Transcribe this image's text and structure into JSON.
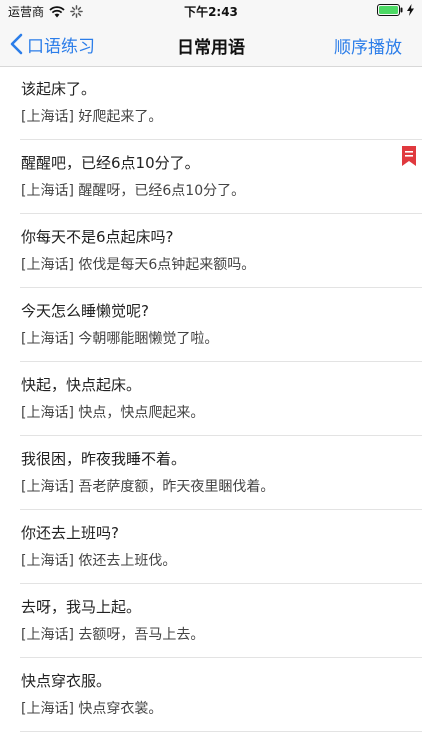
{
  "status_bar": {
    "carrier": "运营商",
    "time": "下午2:43"
  },
  "nav": {
    "back_label": "口语练习",
    "title": "日常用语",
    "play_label": "顺序播放"
  },
  "phrases": [
    {
      "mandarin": "该起床了。",
      "shanghainese": "[上海话] 好爬起来了。",
      "bookmarked": false
    },
    {
      "mandarin": "醒醒吧，已经6点10分了。",
      "shanghainese": "[上海话] 醒醒呀，已经6点10分了。",
      "bookmarked": true
    },
    {
      "mandarin": "你每天不是6点起床吗?",
      "shanghainese": "[上海话] 侬伐是每天6点钟起来额吗。",
      "bookmarked": false
    },
    {
      "mandarin": "今天怎么睡懒觉呢?",
      "shanghainese": "[上海话] 今朝哪能睏懒觉了啦。",
      "bookmarked": false
    },
    {
      "mandarin": "快起，快点起床。",
      "shanghainese": "[上海话] 快点，快点爬起来。",
      "bookmarked": false
    },
    {
      "mandarin": "我很困，昨夜我睡不着。",
      "shanghainese": "[上海话] 吾老萨度额，昨天夜里睏伐着。",
      "bookmarked": false
    },
    {
      "mandarin": "你还去上班吗?",
      "shanghainese": "[上海话] 侬还去上班伐。",
      "bookmarked": false
    },
    {
      "mandarin": "去呀，我马上起。",
      "shanghainese": "[上海话] 去额呀，吾马上去。",
      "bookmarked": false
    },
    {
      "mandarin": "快点穿衣服。",
      "shanghainese": "[上海话] 快点穿衣裳。",
      "bookmarked": false
    }
  ],
  "colors": {
    "accent": "#2b7de9",
    "bookmark": "#e0393e",
    "battery": "#4cd964"
  },
  "icons": {
    "back": "chevron-left-icon",
    "bookmark": "bookmark-icon",
    "wifi": "wifi-icon",
    "loading": "activity-spinner-icon",
    "battery": "battery-icon",
    "charging": "charging-bolt-icon"
  }
}
